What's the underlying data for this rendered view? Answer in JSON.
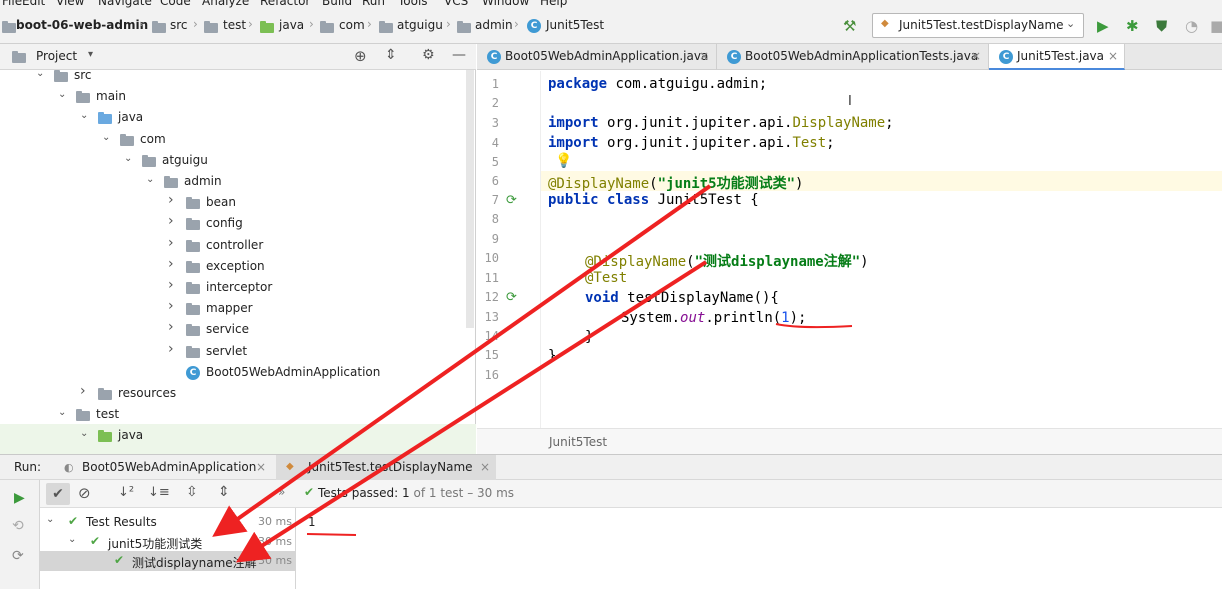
{
  "menubar": [
    "File",
    "Edit",
    "View",
    "Navigate",
    "Code",
    "Analyze",
    "Refactor",
    "Build",
    "Run",
    "Tools",
    "VCS",
    "Window",
    "Help"
  ],
  "breadcrumbs": [
    "boot-06-web-admin",
    "src",
    "test",
    "java",
    "com",
    "atguigu",
    "admin",
    "Junit5Test"
  ],
  "run_config": "Junit5Test.testDisplayName",
  "project_panel": {
    "title": "Project"
  },
  "tree": [
    {
      "label": "src",
      "indent": 0,
      "arrow": "v",
      "icon": "folder"
    },
    {
      "label": "main",
      "indent": 1,
      "arrow": "v",
      "icon": "folder"
    },
    {
      "label": "java",
      "indent": 2,
      "arrow": "v",
      "icon": "folder-blue"
    },
    {
      "label": "com",
      "indent": 3,
      "arrow": "v",
      "icon": "package"
    },
    {
      "label": "atguigu",
      "indent": 4,
      "arrow": "v",
      "icon": "package"
    },
    {
      "label": "admin",
      "indent": 5,
      "arrow": "v",
      "icon": "package"
    },
    {
      "label": "bean",
      "indent": 6,
      "arrow": ">",
      "icon": "package"
    },
    {
      "label": "config",
      "indent": 6,
      "arrow": ">",
      "icon": "package"
    },
    {
      "label": "controller",
      "indent": 6,
      "arrow": ">",
      "icon": "package"
    },
    {
      "label": "exception",
      "indent": 6,
      "arrow": ">",
      "icon": "package"
    },
    {
      "label": "interceptor",
      "indent": 6,
      "arrow": ">",
      "icon": "package"
    },
    {
      "label": "mapper",
      "indent": 6,
      "arrow": ">",
      "icon": "package"
    },
    {
      "label": "service",
      "indent": 6,
      "arrow": ">",
      "icon": "package"
    },
    {
      "label": "servlet",
      "indent": 6,
      "arrow": ">",
      "icon": "package"
    },
    {
      "label": "Boot05WebAdminApplication",
      "indent": 6,
      "arrow": "",
      "icon": "class"
    },
    {
      "label": "resources",
      "indent": 2,
      "arrow": ">",
      "icon": "folder"
    },
    {
      "label": "test",
      "indent": 1,
      "arrow": "v",
      "icon": "folder"
    },
    {
      "label": "java",
      "indent": 2,
      "arrow": "v",
      "icon": "folder-green"
    }
  ],
  "editor_tabs": [
    {
      "label": "Boot05WebAdminApplication.java",
      "active": false
    },
    {
      "label": "Boot05WebAdminApplicationTests.java",
      "active": false
    },
    {
      "label": "Junit5Test.java",
      "active": true
    }
  ],
  "line_numbers": [
    "1",
    "2",
    "3",
    "4",
    "5",
    "6",
    "7",
    "8",
    "9",
    "10",
    "11",
    "12",
    "13",
    "14",
    "15",
    "16"
  ],
  "code": {
    "l1_kw": "package",
    "l1_rest": " com.atguigu.admin;",
    "l3_kw": "import",
    "l3_pkg": " org.junit.jupiter.api.",
    "l3_ann": "DisplayName",
    "l3_end": ";",
    "l4_kw": "import",
    "l4_pkg": " org.junit.jupiter.api.",
    "l4_ann": "Test",
    "l4_end": ";",
    "l6_ann": "@DisplayName",
    "l6_open": "(",
    "l6_str": "\"junit5功能测试类\"",
    "l6_close": ")",
    "l7_kw1": "public",
    "l7_kw2": " class",
    "l7_rest": " Junit5Test {",
    "l10_ann": "@DisplayName",
    "l10_open": "(",
    "l10_str": "\"测试displayname注解\"",
    "l10_close": ")",
    "l11_ann": "@Test",
    "l12_kw": "void",
    "l12_rest": " testDisplayName(){",
    "l13_a": "System.",
    "l13_fld": "out",
    "l13_b": ".println(",
    "l13_num": "1",
    "l13_c": ");",
    "l14": "}",
    "l15": "}"
  },
  "editor_breadcrumb": "Junit5Test",
  "run": {
    "label": "Run:",
    "tabs": [
      {
        "label": "Boot05WebAdminApplication"
      },
      {
        "label": "Junit5Test.testDisplayName"
      }
    ],
    "status_prefix": "Tests passed:",
    "status_count": "1",
    "status_rest": "of 1 test – 30 ms",
    "results": [
      {
        "label": "Test Results",
        "time": "30 ms"
      },
      {
        "label": "junit5功能测试类",
        "time": "30 ms"
      },
      {
        "label": "测试displayname注解",
        "time": "30 ms"
      }
    ],
    "console_output": "1"
  },
  "colors": {
    "annotation": "#808000",
    "keyword": "#0033b3",
    "string": "#067d17",
    "pass": "#4fa545",
    "arrow": "#ee2222"
  }
}
